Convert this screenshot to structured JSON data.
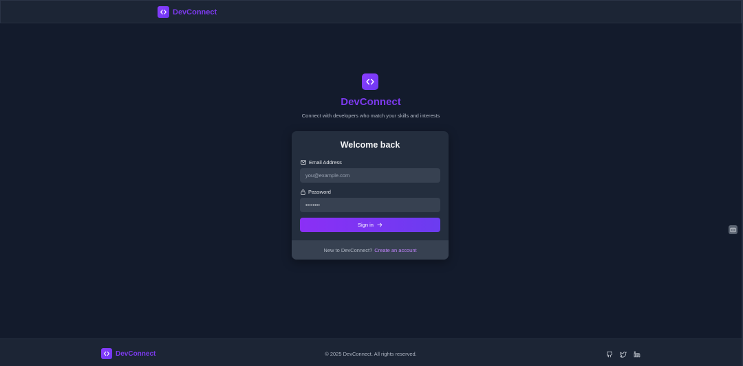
{
  "header": {
    "brand": "DevConnect"
  },
  "hero": {
    "title": "DevConnect",
    "subtitle": "Connect with developers who match your skills and interests"
  },
  "login": {
    "title": "Welcome back",
    "email_label": "Email Address",
    "email_placeholder": "you@example.com",
    "password_label": "Password",
    "password_value": "••••••••",
    "signin_label": "Sign in",
    "footer_text": "New to DevConnect?",
    "create_account_label": "Create an account"
  },
  "footer": {
    "brand": "DevConnect",
    "copyright": "© 2025 DevConnect. All rights reserved.",
    "socials": [
      "github-icon",
      "twitter-icon",
      "linkedin-icon"
    ]
  },
  "colors": {
    "accent": "#7c3aed",
    "background": "#131b2c",
    "card": "#242e3e",
    "input": "#374151",
    "link": "#c084fc"
  }
}
